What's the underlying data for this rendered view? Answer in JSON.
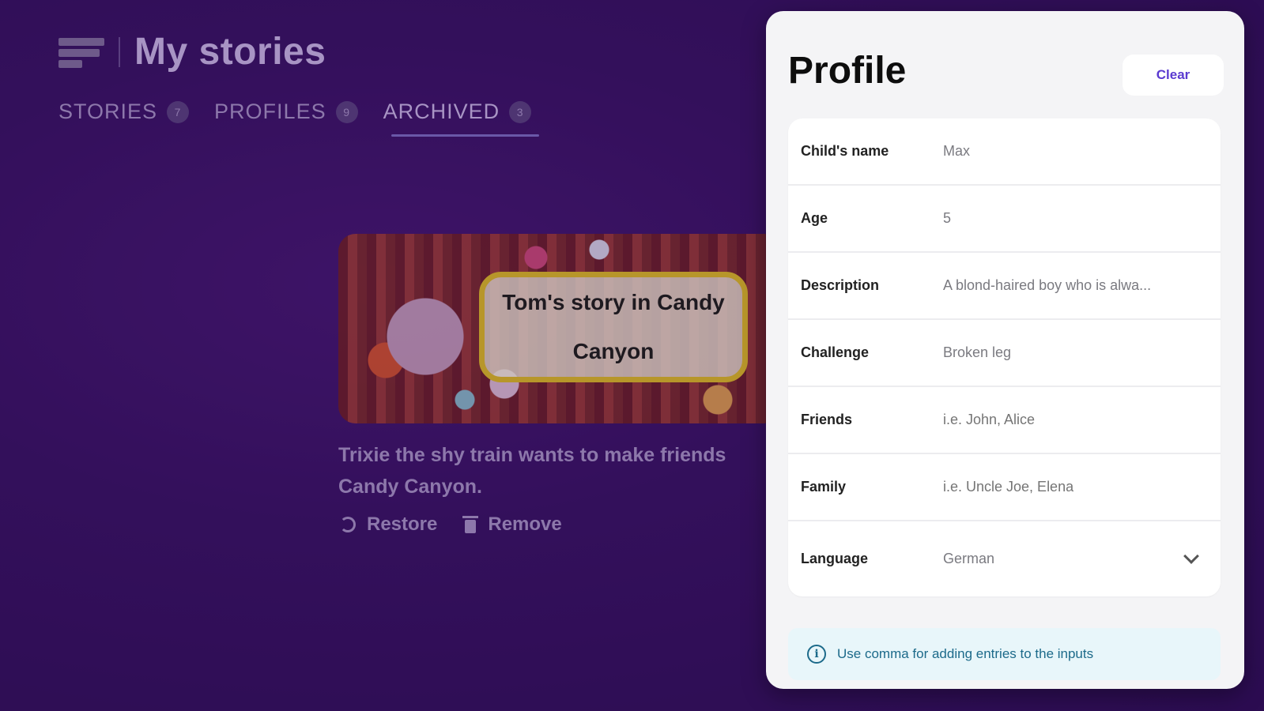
{
  "header": {
    "title": "My stories",
    "logo_icon": "books-logo-icon"
  },
  "tabs": [
    {
      "label": "STORIES",
      "count": "7"
    },
    {
      "label": "PROFILES",
      "count": "9"
    },
    {
      "label": "ARCHIVED",
      "count": "3",
      "active": true
    }
  ],
  "story_card": {
    "image_caption": "Tom's story in Candy Canyon",
    "description": "Trixie the shy train wants to make friends Candy Canyon.",
    "restore_label": "Restore",
    "remove_label": "Remove"
  },
  "profile": {
    "title": "Profile",
    "clear_label": "Clear",
    "fields": {
      "child_name": {
        "label": "Child's name",
        "value": "Max"
      },
      "age": {
        "label": "Age",
        "value": "5"
      },
      "description": {
        "label": "Description",
        "value": "A blond-haired boy who is alwa..."
      },
      "challenge": {
        "label": "Challenge",
        "value": "Broken leg"
      },
      "friends": {
        "label": "Friends",
        "placeholder": "i.e. John, Alice"
      },
      "family": {
        "label": "Family",
        "placeholder": "i.e. Uncle Joe, Elena"
      },
      "language": {
        "label": "Language",
        "value": "German"
      }
    },
    "hint": "Use comma for adding entries to the inputs"
  },
  "colors": {
    "background": "#3a1468",
    "accent": "#5a3ad0",
    "hint_text": "#1c6a8a"
  }
}
